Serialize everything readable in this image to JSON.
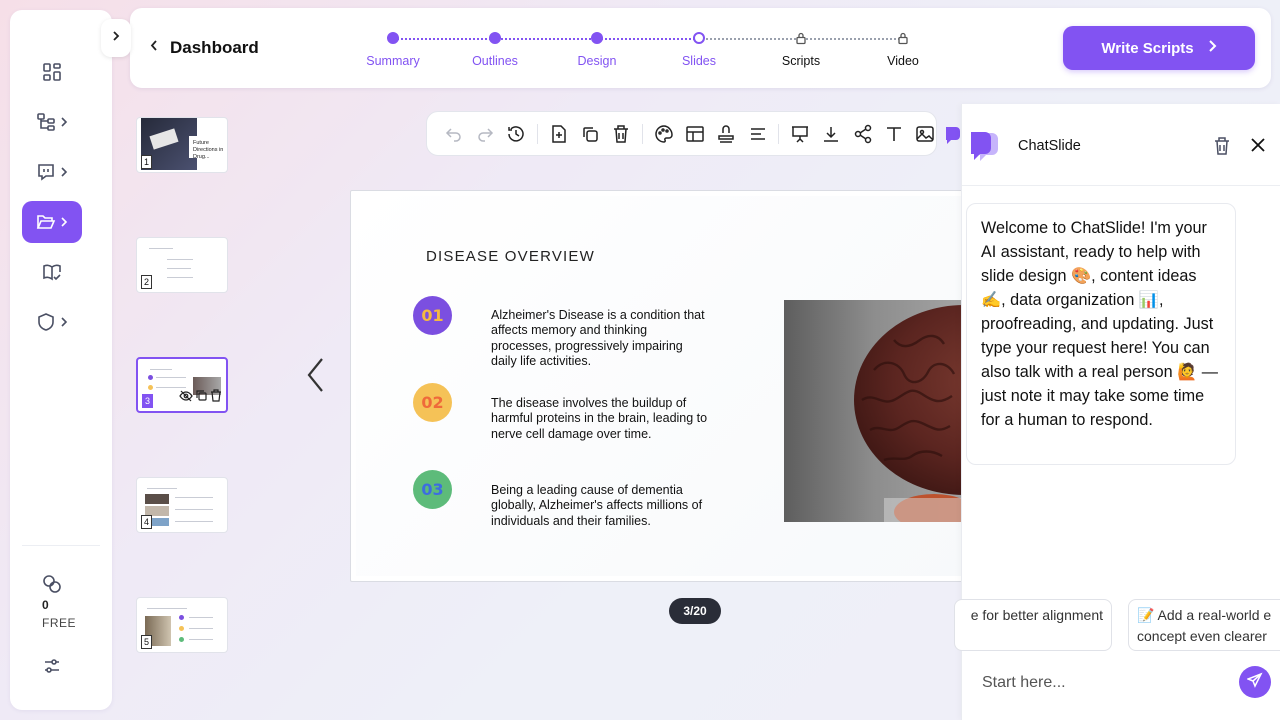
{
  "sidebar": {
    "items": [
      {
        "icon": "grid-icon",
        "has_chevron": false
      },
      {
        "icon": "hierarchy-icon",
        "has_chevron": true
      },
      {
        "icon": "chat-bubble-icon",
        "has_chevron": true
      },
      {
        "icon": "folder-open-icon",
        "has_chevron": true,
        "active": true
      },
      {
        "icon": "book-check-icon",
        "has_chevron": false
      },
      {
        "icon": "shield-icon",
        "has_chevron": true
      }
    ],
    "credits": "0",
    "plan": "FREE"
  },
  "topbar": {
    "back_label": "Dashboard",
    "steps": [
      {
        "label": "Summary",
        "state": "done"
      },
      {
        "label": "Outlines",
        "state": "done"
      },
      {
        "label": "Design",
        "state": "done"
      },
      {
        "label": "Slides",
        "state": "current"
      },
      {
        "label": "Scripts",
        "state": "locked"
      },
      {
        "label": "Video",
        "state": "locked"
      }
    ],
    "cta_label": "Write Scripts"
  },
  "thumbnails": [
    {
      "number": "1",
      "thumb_title": "Future Directions in Drug..."
    },
    {
      "number": "2"
    },
    {
      "number": "3",
      "active": true
    },
    {
      "number": "4"
    },
    {
      "number": "5"
    }
  ],
  "slide": {
    "title": "DISEASE OVERVIEW",
    "points": [
      {
        "number": "01",
        "text": "Alzheimer's Disease is a condition that affects memory and thinking processes, progressively impairing daily life activities.",
        "color": "#7b4fe0",
        "text_color": "#f4b940"
      },
      {
        "number": "02",
        "text": "The disease involves the buildup of harmful proteins in the brain, leading to nerve cell damage over time.",
        "color": "#f5c257",
        "text_color": "#ef6a3a"
      },
      {
        "number": "03",
        "text": "Being a leading cause of dementia globally, Alzheimer's affects millions of individuals and their families.",
        "color": "#5dbb7a",
        "text_color": "#3d6de0"
      }
    ],
    "image": "brain-photo"
  },
  "page_indicator": "3/20",
  "chat": {
    "title": "ChatSlide",
    "welcome": "Welcome to ChatSlide! I'm your AI assistant, ready to help with slide design 🎨, content ideas ✍️, data organization 📊, proofreading, and updating. Just type your request here! You can also talk with a real person 🙋 — just note it may take some time for a human to respond.",
    "suggestions": [
      "e for better alignment",
      "📝 Add a real-world e concept even clearer"
    ],
    "input_placeholder": "Start here..."
  },
  "colors": {
    "accent": "#8253f2",
    "dark_pill": "#2a2d38"
  }
}
